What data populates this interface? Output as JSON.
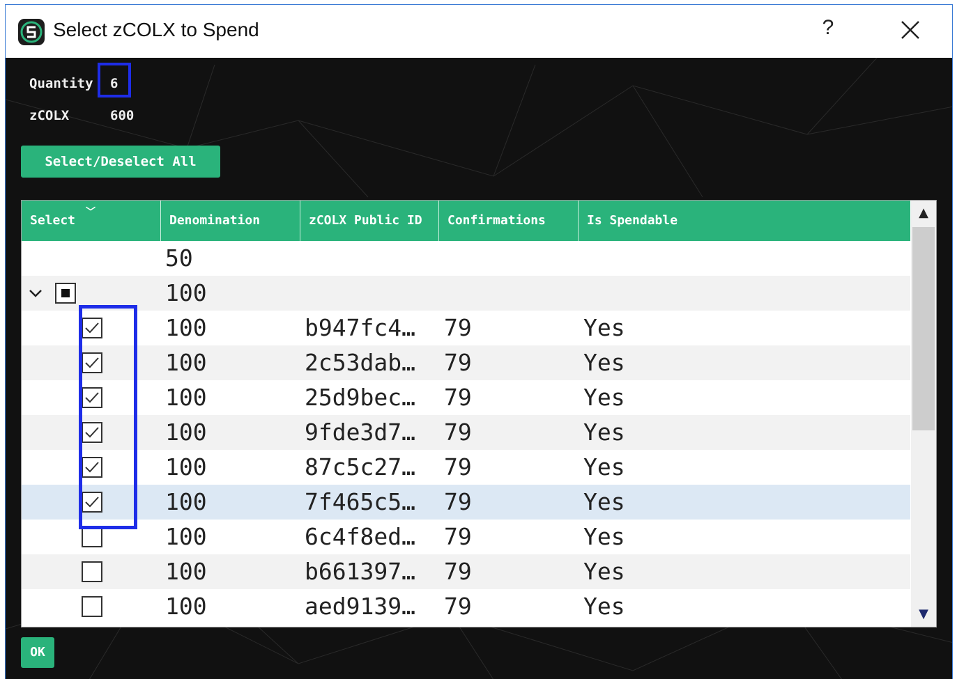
{
  "window": {
    "title": "Select zCOLX to Spend",
    "help_label": "?",
    "icon": "colossus-logo-icon"
  },
  "summary": {
    "quantity_label": "Quantity",
    "quantity_value": "6",
    "zcolx_label": "zCOLX",
    "zcolx_value": "600"
  },
  "toolbar": {
    "select_all_label": "Select/Deselect All"
  },
  "table": {
    "columns": [
      "Select",
      "Denomination",
      "zCOLX Public ID",
      "Confirmations",
      "Is Spendable"
    ],
    "groups": [
      {
        "denomination": "50",
        "expanded": false,
        "state": "none"
      },
      {
        "denomination": "100",
        "expanded": true,
        "state": "partial"
      }
    ],
    "rows": [
      {
        "checked": true,
        "denomination": "100",
        "id": "b947fc4…",
        "confirmations": "79",
        "spendable": "Yes"
      },
      {
        "checked": true,
        "denomination": "100",
        "id": "2c53dab…",
        "confirmations": "79",
        "spendable": "Yes"
      },
      {
        "checked": true,
        "denomination": "100",
        "id": "25d9bec…",
        "confirmations": "79",
        "spendable": "Yes"
      },
      {
        "checked": true,
        "denomination": "100",
        "id": "9fde3d7…",
        "confirmations": "79",
        "spendable": "Yes"
      },
      {
        "checked": true,
        "denomination": "100",
        "id": "87c5c27…",
        "confirmations": "79",
        "spendable": "Yes"
      },
      {
        "checked": true,
        "denomination": "100",
        "id": "7f465c5…",
        "confirmations": "79",
        "spendable": "Yes",
        "highlighted": true
      },
      {
        "checked": false,
        "denomination": "100",
        "id": "6c4f8ed…",
        "confirmations": "79",
        "spendable": "Yes"
      },
      {
        "checked": false,
        "denomination": "100",
        "id": "b661397…",
        "confirmations": "79",
        "spendable": "Yes"
      },
      {
        "checked": false,
        "denomination": "100",
        "id": "aed9139…",
        "confirmations": "79",
        "spendable": "Yes"
      }
    ]
  },
  "footer": {
    "ok_label": "OK"
  },
  "colors": {
    "accent": "#2ab37b",
    "annotation": "#1e2de8",
    "background": "#111111",
    "row_alt": "#f2f2f2",
    "row_highlight": "#dce8f4"
  }
}
